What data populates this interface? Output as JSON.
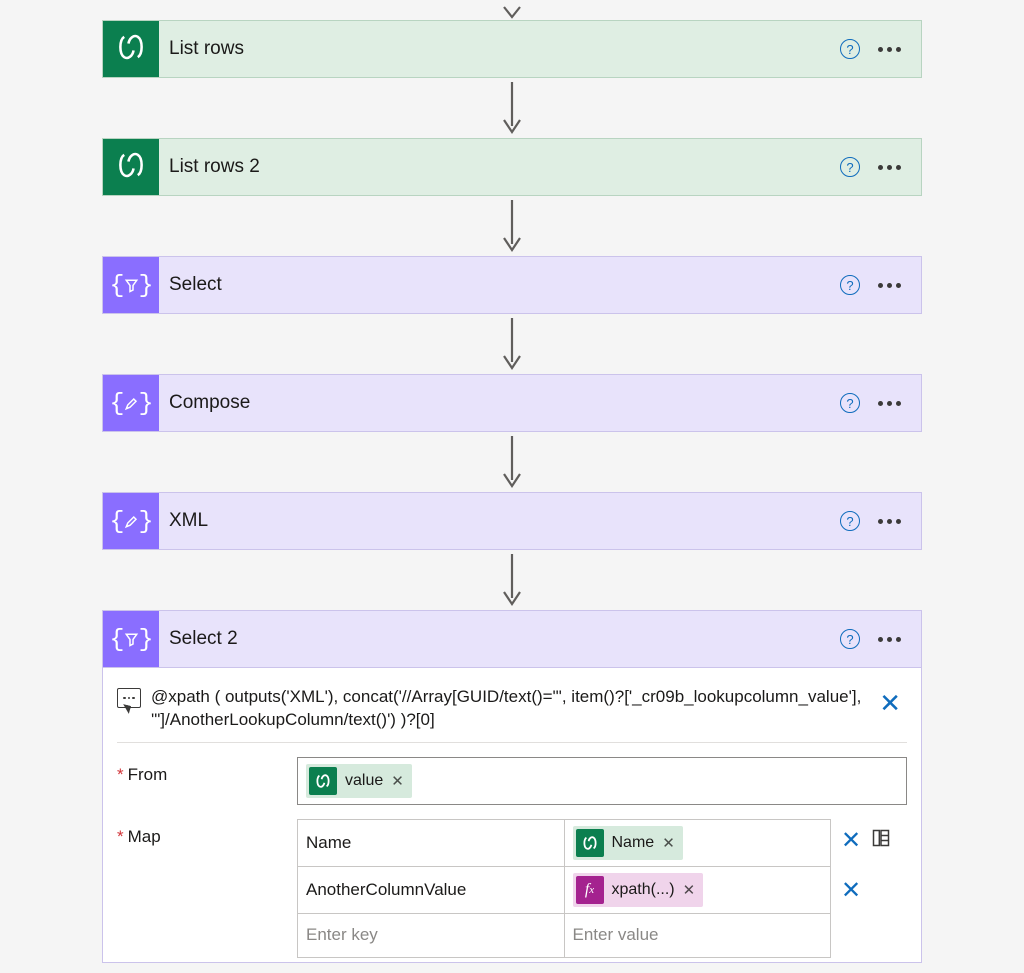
{
  "steps": [
    {
      "id": "list-rows",
      "kind": "dataverse",
      "icon": "swirl",
      "title": "List rows"
    },
    {
      "id": "list-rows-2",
      "kind": "dataverse",
      "icon": "swirl",
      "title": "List rows 2"
    },
    {
      "id": "select",
      "kind": "dataop",
      "icon": "filter",
      "title": "Select"
    },
    {
      "id": "compose",
      "kind": "dataop",
      "icon": "pencil",
      "title": "Compose"
    },
    {
      "id": "xml",
      "kind": "dataop",
      "icon": "pencil",
      "title": "XML"
    },
    {
      "id": "select-2",
      "kind": "dataop",
      "icon": "filter",
      "title": "Select 2"
    }
  ],
  "expanded": {
    "expression": "@xpath ( outputs('XML'), concat('//Array[GUID/text()=\"', item()?['_cr09b_lookupcolumn_value'], '\"]/AnotherLookupColumn/text()') )?[0]",
    "from": {
      "label": "From",
      "token": {
        "kind": "dataverse",
        "text": "value"
      }
    },
    "map": {
      "label": "Map",
      "rows": [
        {
          "key": "Name",
          "value_token": {
            "kind": "dataverse",
            "text": "Name"
          }
        },
        {
          "key": "AnotherColumnValue",
          "value_token": {
            "kind": "fx",
            "text": "xpath(...)"
          }
        }
      ],
      "placeholder_key": "Enter key",
      "placeholder_value": "Enter value"
    }
  },
  "glyphs": {
    "help": "?",
    "close": "✕",
    "token_close": "✕"
  }
}
